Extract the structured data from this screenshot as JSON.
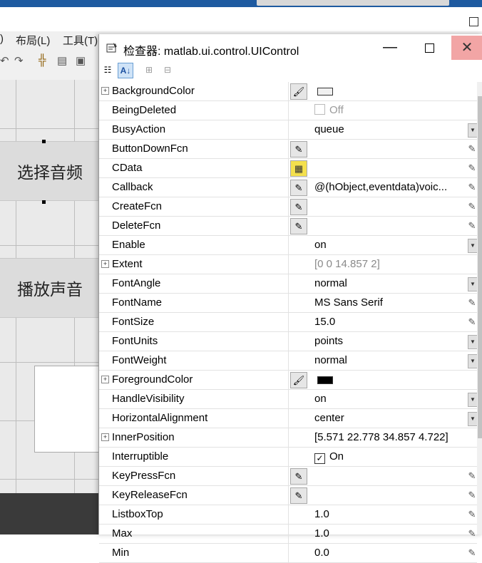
{
  "background_window": {
    "menu": [
      "布局(L)",
      "工具(T)"
    ],
    "menu_partial": ")",
    "canvas_buttons": [
      "选择音频",
      "播放声音"
    ]
  },
  "inspector": {
    "title": "检查器:  matlab.ui.control.UIControl",
    "controls": {
      "minimize": "—",
      "close": "✕"
    },
    "properties": [
      {
        "name": "BackgroundColor",
        "expandable": true,
        "editor": "paint-bucket",
        "swatch": "#f0f0f0"
      },
      {
        "name": "BeingDeleted",
        "checkbox": false,
        "value": "Off",
        "style": "disabled"
      },
      {
        "name": "BusyAction",
        "value": "queue",
        "dropdown": true
      },
      {
        "name": "ButtonDownFcn",
        "editor": "callback-pencil",
        "pencil": true
      },
      {
        "name": "CData",
        "editor": "grid",
        "pencil": true
      },
      {
        "name": "Callback",
        "editor": "callback-pencil",
        "value": "@(hObject,eventdata)voic...",
        "pencil": true
      },
      {
        "name": "CreateFcn",
        "editor": "callback-pencil",
        "pencil": true
      },
      {
        "name": "DeleteFcn",
        "editor": "callback-pencil",
        "pencil": true
      },
      {
        "name": "Enable",
        "value": "on",
        "dropdown": true
      },
      {
        "name": "Extent",
        "expandable": true,
        "value": "[0 0 14.857 2]",
        "style": "readonly"
      },
      {
        "name": "FontAngle",
        "value": "normal",
        "dropdown": true
      },
      {
        "name": "FontName",
        "value": "MS Sans Serif",
        "pencil": true
      },
      {
        "name": "FontSize",
        "value": "15.0",
        "pencil": true
      },
      {
        "name": "FontUnits",
        "value": "points",
        "dropdown": true
      },
      {
        "name": "FontWeight",
        "value": "normal",
        "dropdown": true
      },
      {
        "name": "ForegroundColor",
        "expandable": true,
        "editor": "paint-bucket",
        "swatch": "#000000"
      },
      {
        "name": "HandleVisibility",
        "value": "on",
        "dropdown": true
      },
      {
        "name": "HorizontalAlignment",
        "value": "center",
        "dropdown": true
      },
      {
        "name": "InnerPosition",
        "expandable": true,
        "value": "[5.571 22.778 34.857 4.722]"
      },
      {
        "name": "Interruptible",
        "checkbox": true,
        "value": "On"
      },
      {
        "name": "KeyPressFcn",
        "editor": "callback-pencil",
        "pencil": true
      },
      {
        "name": "KeyReleaseFcn",
        "editor": "callback-pencil",
        "pencil": true
      },
      {
        "name": "ListboxTop",
        "value": "1.0",
        "pencil": true
      },
      {
        "name": "Max",
        "value": "1.0",
        "pencil": true
      },
      {
        "name": "Min",
        "value": "0.0",
        "pencil": true
      }
    ]
  }
}
